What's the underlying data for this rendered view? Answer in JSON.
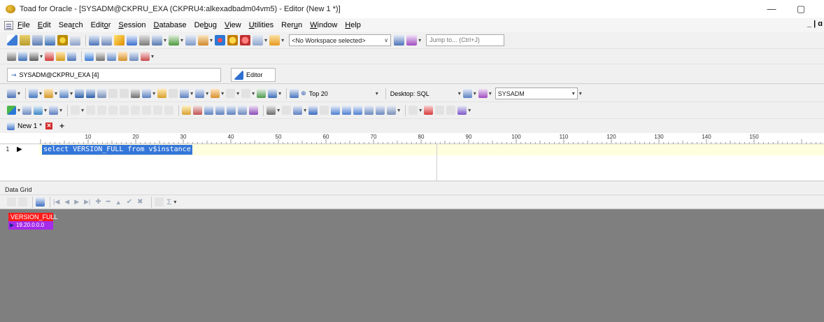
{
  "window": {
    "title": "Toad for Oracle - [SYSADM@CKPRU_EXA (CKPRU4:alkexadbadm04vm5) - Editor (New 1 *)]",
    "minimize_glyph": "—",
    "restore_glyph": "▢"
  },
  "menu": {
    "items": [
      {
        "label": "File",
        "u": "F",
        "rest": "ile"
      },
      {
        "label": "Edit",
        "u": "E",
        "rest": "dit"
      },
      {
        "label": "Search",
        "pre": "Sea",
        "u": "r",
        "rest": "ch"
      },
      {
        "label": "Editor",
        "pre": "Edit",
        "u": "o",
        "rest": "r"
      },
      {
        "label": "Session",
        "u": "S",
        "rest": "ession"
      },
      {
        "label": "Database",
        "u": "D",
        "rest": "atabase"
      },
      {
        "label": "Debug",
        "pre": "De",
        "u": "b",
        "rest": "ug"
      },
      {
        "label": "View",
        "u": "V",
        "rest": "iew"
      },
      {
        "label": "Utilities",
        "u": "U",
        "rest": "tilities"
      },
      {
        "label": "Rerun",
        "pre": "Rer",
        "u": "u",
        "rest": "n"
      },
      {
        "label": "Window",
        "u": "W",
        "rest": "indow"
      },
      {
        "label": "Help",
        "u": "H",
        "rest": "elp"
      }
    ],
    "mdi_controls": "_ | ɑ"
  },
  "toolbar_main": {
    "workspace_select": "<No Workspace selected>",
    "jump_placeholder": "Jump to... (Ctrl+J)"
  },
  "connection": {
    "tab_label": "SYSADM@CKPRU_EXA [4]",
    "editor_tab_label": "Editor"
  },
  "editor_toolbar": {
    "top_label": "Top 20",
    "desktop_label": "Desktop: SQL",
    "schema_value": "SYSADM"
  },
  "document_tabs": {
    "active_label": "New 1 *",
    "close_glyph": "✕",
    "add_glyph": "+"
  },
  "ruler": {
    "labels": [
      "10",
      "20",
      "30",
      "40",
      "50",
      "60",
      "70",
      "80",
      "90",
      "100",
      "110",
      "120",
      "130",
      "140",
      "150"
    ]
  },
  "editor": {
    "line_number": "1",
    "line_marker": "▶",
    "code": "select VERSION_FULL from v$instance"
  },
  "data_grid": {
    "header_label": "Data Grid",
    "nav_sigma": "Σ",
    "column_header": "VERSION_FULL",
    "row_indicator": "▶",
    "rows": [
      "19.20.0.0.0"
    ]
  },
  "colors": {
    "selection": "#3476d9",
    "current_line": "#ffffe0",
    "grid_background": "#7f7f7f",
    "column_header": "#ff1a1a",
    "row_highlight": "#a52ce8"
  }
}
